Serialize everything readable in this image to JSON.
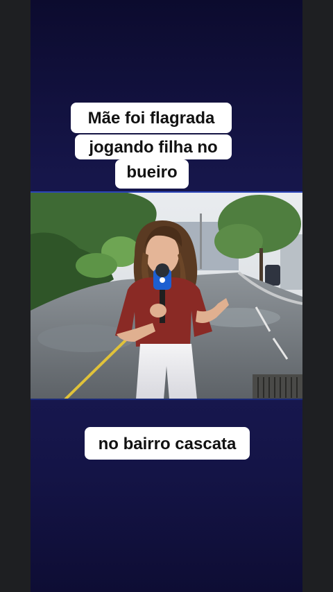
{
  "caption_top": {
    "line1": "Mãe foi flagrada",
    "line2": "jogando filha no",
    "line3": "bueiro"
  },
  "caption_bottom": "no bairro cascata",
  "colors": {
    "background": "#1a1a55",
    "caption_bg": "#ffffff",
    "caption_text": "#111111",
    "shirt": "#8a2a25",
    "microphone": "#1d5fd1"
  },
  "photo_subject": "reporter-with-microphone"
}
